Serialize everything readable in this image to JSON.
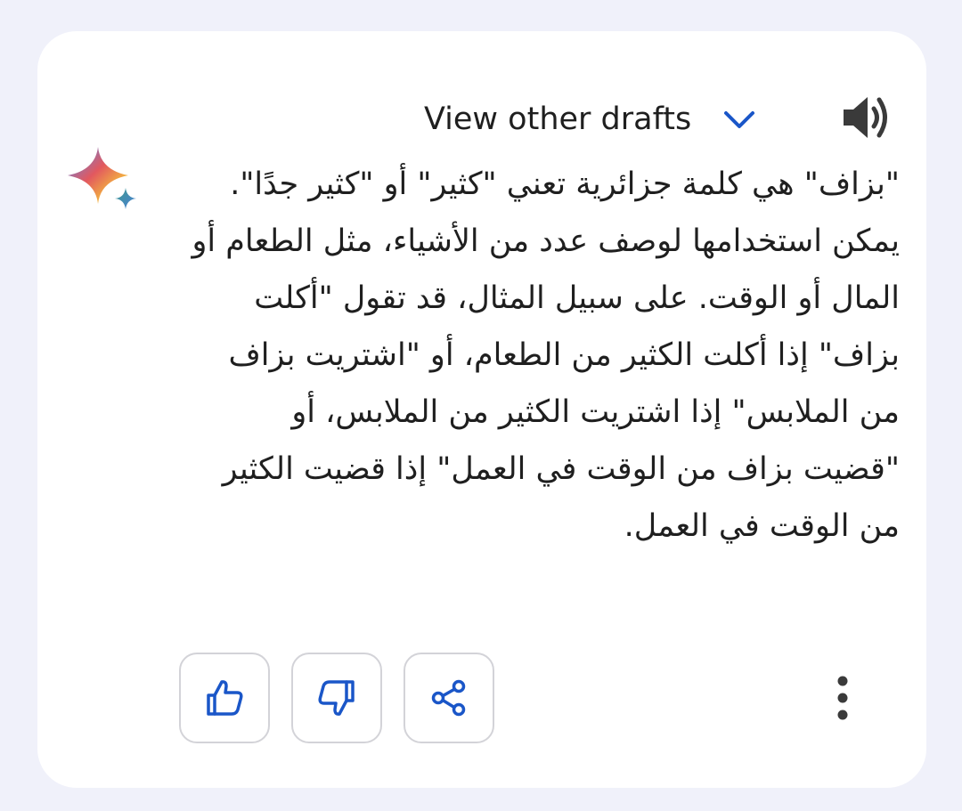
{
  "header": {
    "view_drafts_label": "View other drafts",
    "chevron_icon": "chevron-down-icon",
    "speaker_icon": "speaker-icon"
  },
  "response": {
    "assistant_icon": "sparkle-icon",
    "text": "\"بزاف\" هي كلمة جزائرية تعني \"كثير\" أو \"كثير جدًا\". يمكن استخدامها لوصف عدد من الأشياء، مثل الطعام أو المال أو الوقت. على سبيل المثال، قد تقول \"أكلت بزاف\" إذا أكلت الكثير من الطعام، أو \"اشتريت بزاف من الملابس\" إذا اشتريت الكثير من الملابس، أو \"قضيت بزاف من الوقت في العمل\" إذا قضيت الكثير من الوقت في العمل."
  },
  "actions": {
    "thumbs_up_icon": "thumbs-up-icon",
    "thumbs_down_icon": "thumbs-down-icon",
    "share_icon": "share-icon",
    "more_icon": "more-vert-icon"
  },
  "colors": {
    "page_background": "#f0f1fa",
    "card_background": "#ffffff",
    "accent_blue": "#1a56c8",
    "text_dark": "#1f1f1f",
    "button_border": "#d3d3d8"
  }
}
